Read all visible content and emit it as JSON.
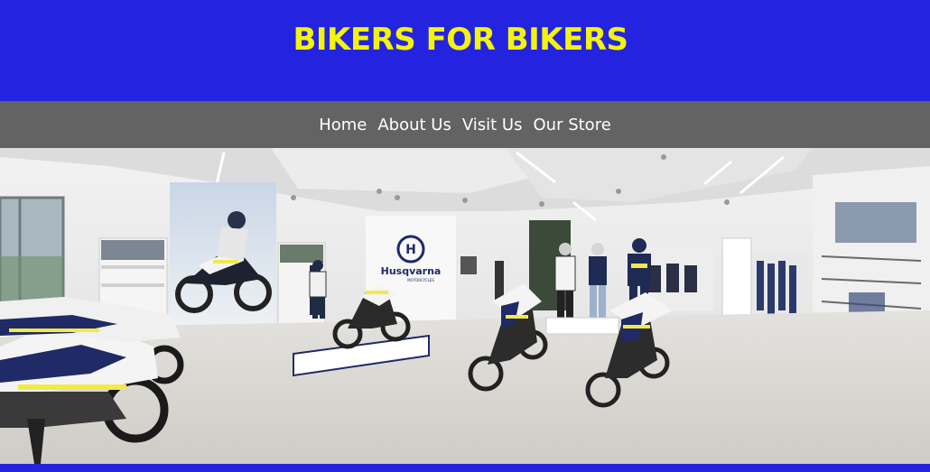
{
  "site": {
    "title": "BIKERS FOR BIKERS",
    "brand_color": "#2424e0",
    "title_color": "#f4f40a",
    "nav_color": "#636363"
  },
  "nav": {
    "items": [
      {
        "label": "Home"
      },
      {
        "label": "About Us"
      },
      {
        "label": "Visit Us"
      },
      {
        "label": "Our Store"
      }
    ]
  },
  "hero": {
    "logo_text": "Husqvarna",
    "logo_subtext": "MOTORCYCLES"
  }
}
